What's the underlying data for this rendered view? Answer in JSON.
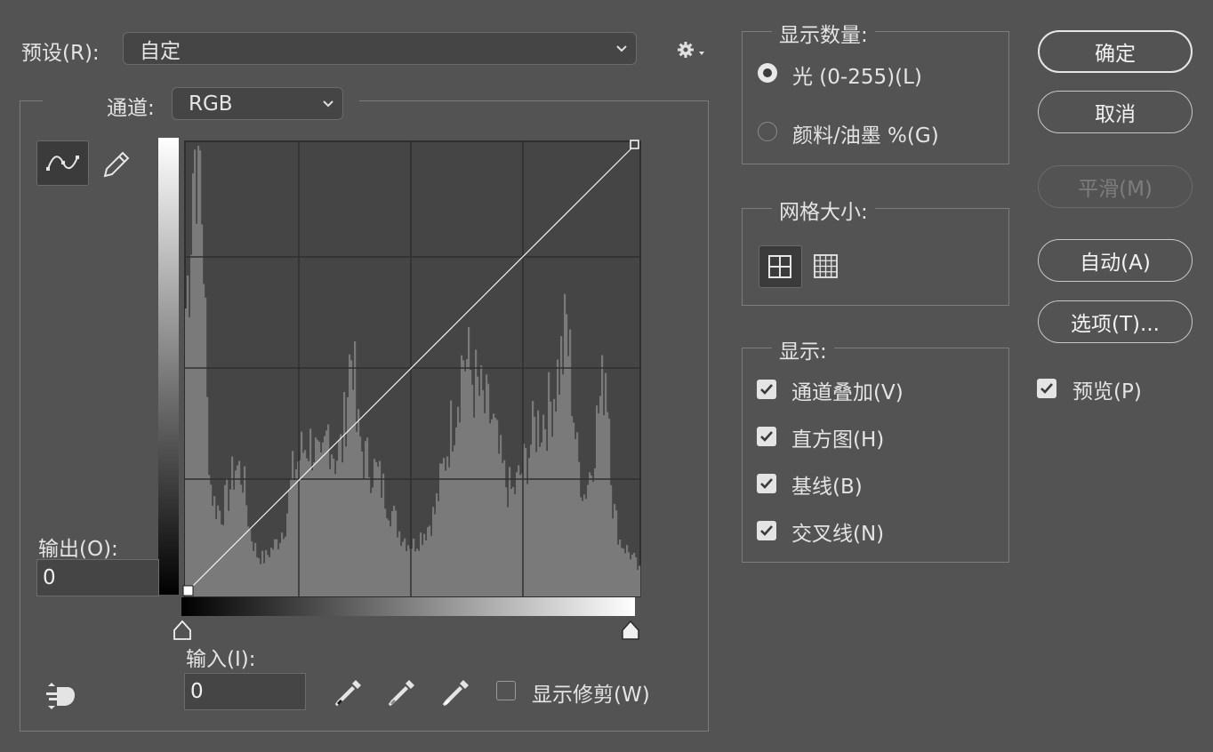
{
  "preset": {
    "label": "预设(R):",
    "value": "自定"
  },
  "channel": {
    "label": "通道:",
    "value": "RGB"
  },
  "output": {
    "label": "输出(O):",
    "value": "0"
  },
  "input": {
    "label": "输入(I):",
    "value": "0"
  },
  "show_clipping": {
    "label": "显示修剪(W)",
    "checked": false
  },
  "show_amount": {
    "title": "显示数量:",
    "options": [
      {
        "label": "光 (0-255)(L)",
        "selected": true
      },
      {
        "label": "颜料/油墨 %(G)",
        "selected": false
      }
    ]
  },
  "grid_size": {
    "title": "网格大小:",
    "selected": "simple"
  },
  "display": {
    "title": "显示:",
    "items": [
      {
        "label": "通道叠加(V)",
        "checked": true
      },
      {
        "label": "直方图(H)",
        "checked": true
      },
      {
        "label": "基线(B)",
        "checked": true
      },
      {
        "label": "交叉线(N)",
        "checked": true
      }
    ]
  },
  "buttons": {
    "ok": "确定",
    "cancel": "取消",
    "smooth": "平滑(M)",
    "auto": "自动(A)",
    "options": "选项(T)..."
  },
  "preview": {
    "label": "预览(P)",
    "checked": true
  },
  "icons": {
    "curve_tool": "curve-point-icon",
    "pencil_tool": "pencil-icon",
    "gear": "gear-icon",
    "on_image_adjust": "hand-adjust-icon",
    "eyedropper_black": "black-point-eyedropper-icon",
    "eyedropper_gray": "gray-point-eyedropper-icon",
    "eyedropper_white": "white-point-eyedropper-icon"
  },
  "curve": {
    "points": [
      [
        0,
        0
      ],
      [
        255,
        255
      ]
    ]
  }
}
